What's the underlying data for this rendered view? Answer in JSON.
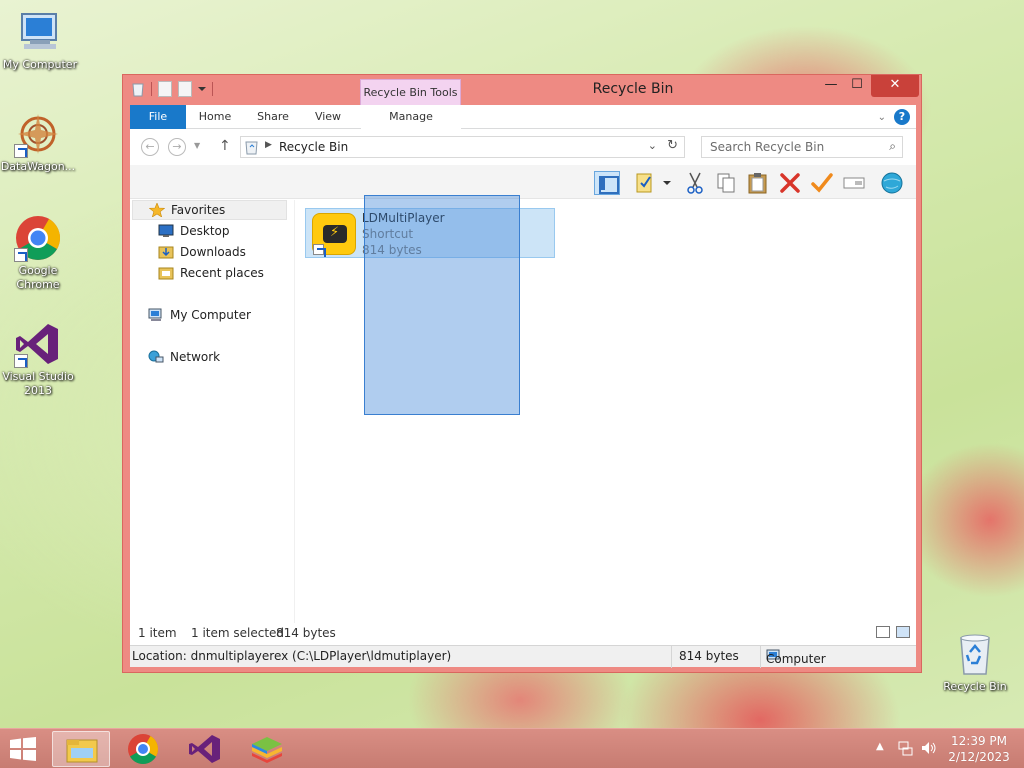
{
  "desktop": {
    "icons": [
      {
        "label": "My Computer"
      },
      {
        "label": "DataWagon..."
      },
      {
        "label": "Google Chrome"
      },
      {
        "label": "Visual Studio 2013"
      },
      {
        "label": "Recycle Bin"
      }
    ]
  },
  "window": {
    "title": "Recycle Bin",
    "context_tab": "Recycle Bin Tools",
    "close_glyph": "✕",
    "min_glyph": "—",
    "max_glyph": "☐"
  },
  "ribbon": {
    "tabs": [
      {
        "label": "File"
      },
      {
        "label": "Home"
      },
      {
        "label": "Share"
      },
      {
        "label": "View"
      },
      {
        "label": "Manage"
      }
    ],
    "help": "?"
  },
  "address": {
    "path": "Recycle Bin",
    "search_placeholder": "Search Recycle Bin"
  },
  "nav": {
    "favorites": "Favorites",
    "items": [
      {
        "label": "Desktop"
      },
      {
        "label": "Downloads"
      },
      {
        "label": "Recent places"
      }
    ],
    "computer": "My Computer",
    "network": "Network"
  },
  "file": {
    "name": "LDMultiPlayer",
    "type": "Shortcut",
    "size": "814 bytes"
  },
  "status": {
    "count": "1 item",
    "selected": "1 item selected",
    "selected_size": "814 bytes"
  },
  "details": {
    "location": "Location: dnmultiplayerex (C:\\LDPlayer\\ldmutiplayer)",
    "size": "814 bytes",
    "zone": "Computer"
  },
  "taskbar": {
    "time": "12:39 PM",
    "date": "2/12/2023"
  },
  "colors": {
    "window_frame": "#ee8a83",
    "file_tab": "#1979ca",
    "context_tab": "#f3d3f0",
    "close_button": "#c9413a",
    "selection": "#cce4f7"
  }
}
